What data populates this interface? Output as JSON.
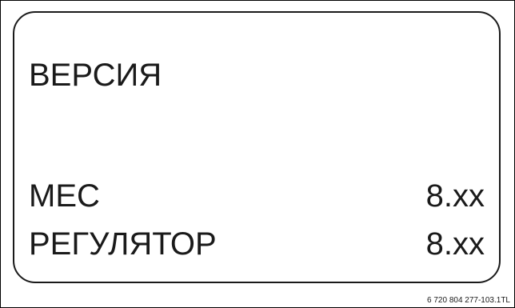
{
  "display": {
    "title": "ВЕРСИЯ",
    "rows": [
      {
        "label": "МЕС",
        "value": "8.xx"
      },
      {
        "label": "РЕГУЛЯТОР",
        "value": "8.xx"
      }
    ]
  },
  "figure_code": "6 720 804 277-103.1TL",
  "colors": {
    "text": "#1a1a1a",
    "background": "#ffffff",
    "border": "#1a1a1a"
  }
}
